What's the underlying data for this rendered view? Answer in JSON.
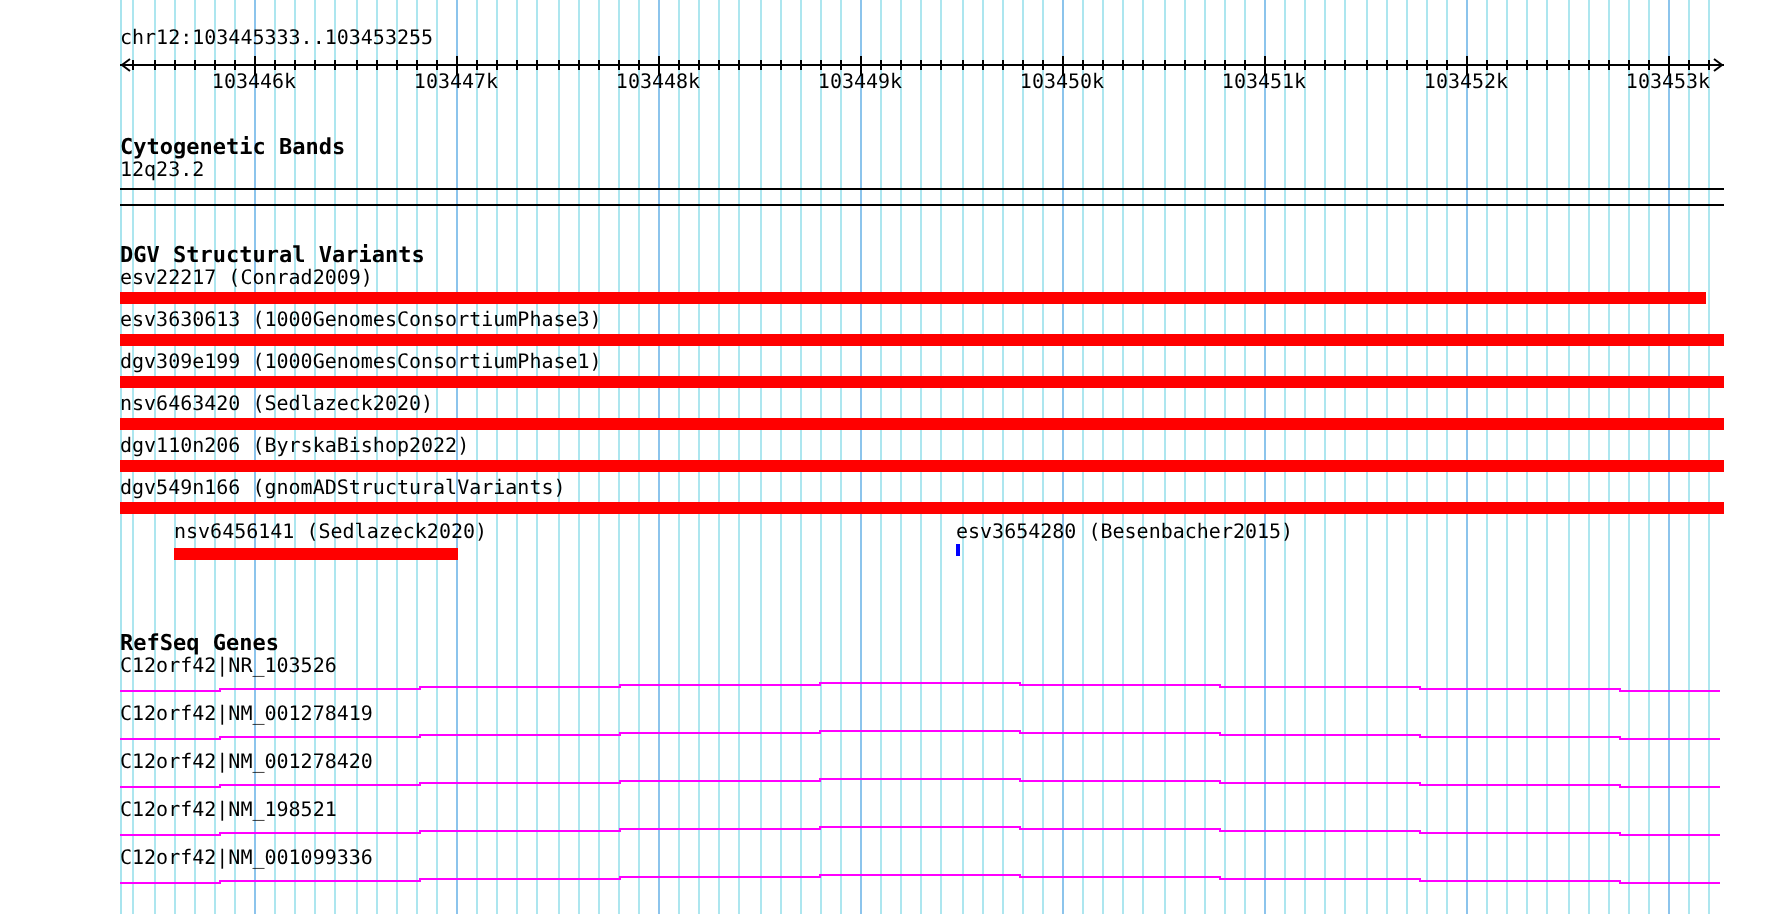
{
  "location": "chr12:103445333..103453255",
  "ruler": {
    "tick_labels": [
      "103446k",
      "103447k",
      "103448k",
      "103449k",
      "103450k",
      "103451k",
      "103452k",
      "103453k"
    ]
  },
  "tracks": [
    {
      "kind": "cytoband",
      "title": "Cytogenetic Bands",
      "band": "12q23.2"
    },
    {
      "kind": "variants",
      "title": "DGV Structural Variants",
      "rows": [
        [
          {
            "label": "esv22217 (Conrad2009)",
            "color": "#ff0000"
          }
        ],
        [
          {
            "label": "esv3630613 (1000GenomesConsortiumPhase3)",
            "color": "#ff0000"
          }
        ],
        [
          {
            "label": "dgv309e199 (1000GenomesConsortiumPhase1)",
            "color": "#ff0000"
          }
        ],
        [
          {
            "label": "nsv6463420 (Sedlazeck2020)",
            "color": "#ff0000"
          }
        ],
        [
          {
            "label": "dgv110n206 (ByrskaBishop2022)",
            "color": "#ff0000"
          }
        ],
        [
          {
            "label": "dgv549n166 (gnomADStructuralVariants)",
            "color": "#ff0000"
          }
        ],
        [
          {
            "label": "nsv6456141 (Sedlazeck2020)",
            "color": "#ff0000"
          },
          {
            "label": "esv3654280 (Besenbacher2015)",
            "color": "#0000ff"
          }
        ]
      ]
    },
    {
      "kind": "genes",
      "title": "RefSeq Genes",
      "genes": [
        {
          "label": "C12orf42|NR_103526"
        },
        {
          "label": "C12orf42|NM_001278419"
        },
        {
          "label": "C12orf42|NM_001278420"
        },
        {
          "label": "C12orf42|NM_198521"
        },
        {
          "label": "C12orf42|NM_001099336"
        }
      ]
    }
  ]
}
